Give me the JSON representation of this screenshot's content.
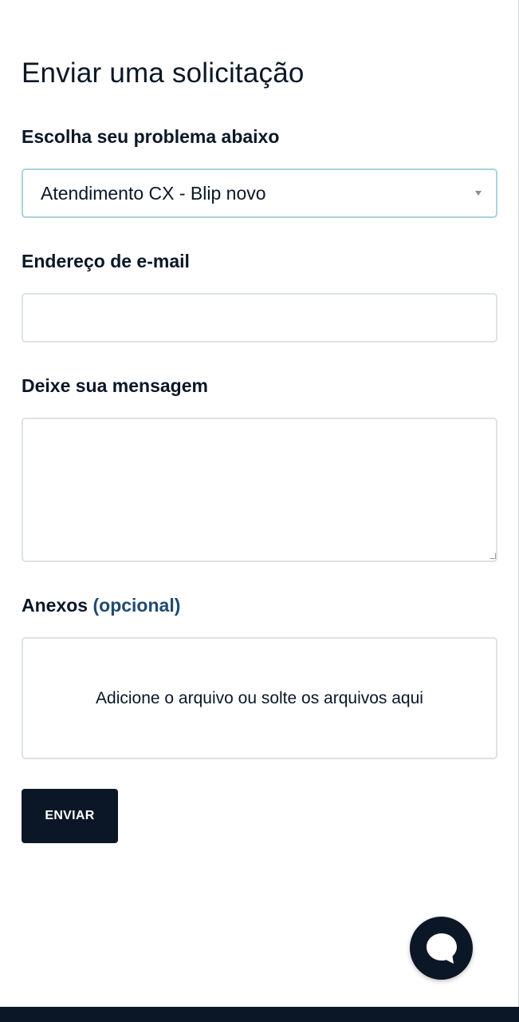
{
  "page": {
    "title": "Enviar uma solicitação"
  },
  "form": {
    "problem": {
      "label": "Escolha seu problema abaixo",
      "selected_value": "Atendimento CX - Blip novo"
    },
    "email": {
      "label": "Endereço de e-mail",
      "value": ""
    },
    "message": {
      "label": "Deixe sua mensagem",
      "value": ""
    },
    "attachments": {
      "label": "Anexos",
      "optional_label": "(opcional)",
      "dropzone_text": "Adicione o arquivo ou solte os arquivos aqui"
    },
    "submit_label": "ENVIAR"
  },
  "chat": {
    "icon": "chat-bubble-icon"
  },
  "colors": {
    "primary": "#0b1726",
    "select_border": "#a9d3de",
    "input_border": "#dfe2e4",
    "optional_text": "#1f4a72",
    "background": "#ffffff"
  }
}
